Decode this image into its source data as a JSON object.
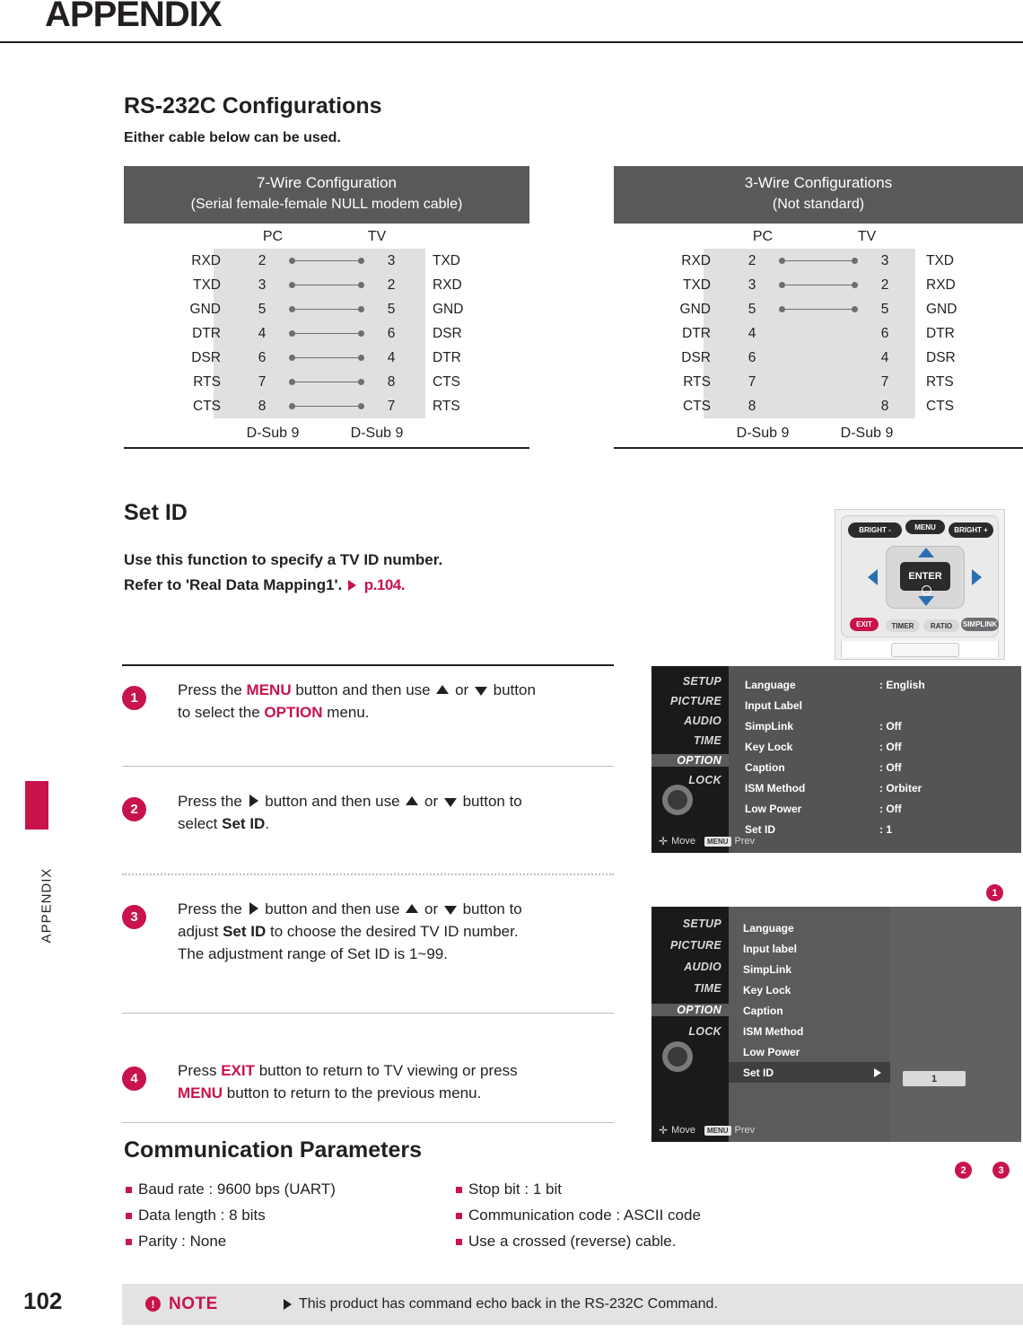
{
  "header": {
    "title": "APPENDIX",
    "side_label": "APPENDIX",
    "page_number": "102"
  },
  "rs232": {
    "title": "RS-232C Configurations",
    "subtitle": "Either cable below can be used.",
    "table7": {
      "head_line1": "7-Wire Configuration",
      "head_line2": "(Serial female-female NULL modem cable)",
      "col_pc": "PC",
      "col_tv": "TV",
      "rows": [
        {
          "left": "RXD",
          "pc": "2",
          "tv": "3",
          "right": "TXD",
          "connected": true
        },
        {
          "left": "TXD",
          "pc": "3",
          "tv": "2",
          "right": "RXD",
          "connected": true
        },
        {
          "left": "GND",
          "pc": "5",
          "tv": "5",
          "right": "GND",
          "connected": true
        },
        {
          "left": "DTR",
          "pc": "4",
          "tv": "6",
          "right": "DSR",
          "connected": true
        },
        {
          "left": "DSR",
          "pc": "6",
          "tv": "4",
          "right": "DTR",
          "connected": true
        },
        {
          "left": "RTS",
          "pc": "7",
          "tv": "8",
          "right": "CTS",
          "connected": true
        },
        {
          "left": "CTS",
          "pc": "8",
          "tv": "7",
          "right": "RTS",
          "connected": true
        }
      ],
      "footer_left": "D-Sub 9",
      "footer_right": "D-Sub 9"
    },
    "table3": {
      "head_line1": "3-Wire Configurations",
      "head_line2": "(Not standard)",
      "col_pc": "PC",
      "col_tv": "TV",
      "rows": [
        {
          "left": "RXD",
          "pc": "2",
          "tv": "3",
          "right": "TXD",
          "connected": true
        },
        {
          "left": "TXD",
          "pc": "3",
          "tv": "2",
          "right": "RXD",
          "connected": true
        },
        {
          "left": "GND",
          "pc": "5",
          "tv": "5",
          "right": "GND",
          "connected": true
        },
        {
          "left": "DTR",
          "pc": "4",
          "tv": "6",
          "right": "DTR",
          "connected": false
        },
        {
          "left": "DSR",
          "pc": "6",
          "tv": "4",
          "right": "DSR",
          "connected": false
        },
        {
          "left": "RTS",
          "pc": "7",
          "tv": "7",
          "right": "RTS",
          "connected": false
        },
        {
          "left": "CTS",
          "pc": "8",
          "tv": "8",
          "right": "CTS",
          "connected": false
        }
      ],
      "footer_left": "D-Sub 9",
      "footer_right": "D-Sub 9"
    }
  },
  "setid": {
    "title": "Set ID",
    "desc_line1": "Use this function to specify a TV ID number.",
    "desc_line2_a": "Refer to 'Real Data Mapping1'.",
    "desc_line2_b": "p.104.",
    "steps": [
      {
        "num": "1",
        "parts": [
          {
            "t": "Press the ",
            "s": "n"
          },
          {
            "t": "MENU",
            "s": "pink"
          },
          {
            "t": " button and then use ",
            "s": "n"
          },
          {
            "t": "[up]",
            "s": "tri-up"
          },
          {
            "t": " or ",
            "s": "n"
          },
          {
            "t": "[down]",
            "s": "tri-dn"
          },
          {
            "t": " button",
            "s": "n"
          },
          {
            "t": "\nto select the ",
            "s": "n"
          },
          {
            "t": "OPTION",
            "s": "pink"
          },
          {
            "t": " menu.",
            "s": "n"
          }
        ]
      },
      {
        "num": "2",
        "parts": [
          {
            "t": "Press the ",
            "s": "n"
          },
          {
            "t": "[right]",
            "s": "tri-rt"
          },
          {
            "t": " button and then use ",
            "s": "n"
          },
          {
            "t": "[up]",
            "s": "tri-up"
          },
          {
            "t": " or ",
            "s": "n"
          },
          {
            "t": "[down]",
            "s": "tri-dn"
          },
          {
            "t": " button to",
            "s": "n"
          },
          {
            "t": "\nselect ",
            "s": "n"
          },
          {
            "t": "Set ID",
            "s": "b"
          },
          {
            "t": ".",
            "s": "n"
          }
        ]
      },
      {
        "num": "3",
        "parts": [
          {
            "t": "Press the ",
            "s": "n"
          },
          {
            "t": "[right]",
            "s": "tri-rt"
          },
          {
            "t": " button and then use  ",
            "s": "n"
          },
          {
            "t": "[up]",
            "s": "tri-up"
          },
          {
            "t": " or ",
            "s": "n"
          },
          {
            "t": "[down]",
            "s": "tri-dn"
          },
          {
            "t": " button to",
            "s": "n"
          },
          {
            "t": "\nadjust ",
            "s": "n"
          },
          {
            "t": "Set ID",
            "s": "b"
          },
          {
            "t": " to choose the desired TV ID number.",
            "s": "n"
          },
          {
            "t": "\nThe adjustment range of Set ID is 1~99.",
            "s": "n"
          }
        ]
      },
      {
        "num": "4",
        "parts": [
          {
            "t": "Press ",
            "s": "n"
          },
          {
            "t": "EXIT",
            "s": "pink"
          },
          {
            "t": " button to return to TV viewing or press",
            "s": "n"
          },
          {
            "t": "\nMENU",
            "s": "pink"
          },
          {
            "t": " button to return to the previous menu.",
            "s": "n"
          }
        ]
      }
    ]
  },
  "remote": {
    "bright_minus": "BRIGHT -",
    "menu": "MENU",
    "bright_plus": "BRIGHT +",
    "enter": "ENTER",
    "exit": "EXIT",
    "timer": "TIMER",
    "ratio": "RATIO",
    "simplink": "SIMPLINK"
  },
  "osd1": {
    "callout": "1",
    "menu_items": [
      "SETUP",
      "PICTURE",
      "AUDIO",
      "TIME",
      "OPTION",
      "LOCK"
    ],
    "selected_menu": "OPTION",
    "rows": [
      {
        "label": "Language",
        "value": ": English"
      },
      {
        "label": "Input Label",
        "value": ""
      },
      {
        "label": "SimpLink",
        "value": ": Off"
      },
      {
        "label": "Key Lock",
        "value": ": Off"
      },
      {
        "label": "Caption",
        "value": ": Off"
      },
      {
        "label": "ISM Method",
        "value": ": Orbiter"
      },
      {
        "label": "Low Power",
        "value": ": Off"
      },
      {
        "label": "Set ID",
        "value": ": 1"
      }
    ],
    "footer_move": "Move",
    "footer_chip": "MENU",
    "footer_prev": "Prev"
  },
  "osd2": {
    "callout_a": "2",
    "callout_b": "3",
    "menu_items": [
      "SETUP",
      "PICTURE",
      "AUDIO",
      "TIME",
      "OPTION",
      "LOCK"
    ],
    "selected_menu": "OPTION",
    "rows": [
      {
        "label": "Language",
        "selected": false
      },
      {
        "label": "Input label",
        "selected": false
      },
      {
        "label": "SimpLink",
        "selected": false
      },
      {
        "label": "Key Lock",
        "selected": false
      },
      {
        "label": "Caption",
        "selected": false
      },
      {
        "label": "ISM Method",
        "selected": false
      },
      {
        "label": "Low Power",
        "selected": false
      },
      {
        "label": "Set ID",
        "selected": true
      }
    ],
    "value_box": "1",
    "footer_move": "Move",
    "footer_chip": "MENU",
    "footer_prev": "Prev"
  },
  "comm": {
    "title": "Communication Parameters",
    "left_items": [
      "Baud rate : 9600 bps (UART)",
      "Data length : 8 bits",
      "Parity : None"
    ],
    "right_items": [
      "Stop bit : 1 bit",
      "Communication code : ASCII code",
      "Use a crossed (reverse) cable."
    ]
  },
  "note": {
    "label": "NOTE",
    "text": "This product has command echo back in the RS-232C Command."
  },
  "colors": {
    "accent": "#c8134b",
    "headbar": "#58595b",
    "table_grey": "#e0e0e0"
  }
}
